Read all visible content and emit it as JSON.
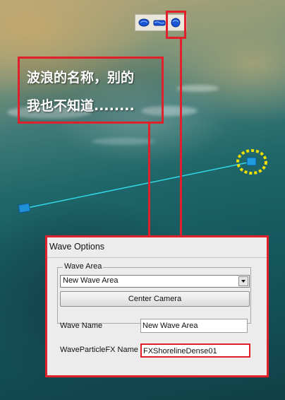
{
  "callout": {
    "line1": "波浪的名称，别的",
    "line2": "我也不知道........"
  },
  "toolbar": {
    "icons": [
      "wave-brush-icon",
      "wave-line-icon",
      "wave-select-icon"
    ]
  },
  "dialog": {
    "title": "Wave Options",
    "wave_area_group_label": "Wave Area",
    "wave_area_value": "New Wave Area",
    "center_camera_label": "Center Camera",
    "wave_name_label": "Wave Name",
    "wave_name_value": "New Wave Area",
    "particle_fx_label": "WaveParticleFX Name",
    "particle_fx_value": "FXShorelineDense01"
  },
  "colors": {
    "annotation_red": "#e0212b",
    "wave_line": "#33d6e6",
    "marker_yellow": "#f0e000"
  }
}
